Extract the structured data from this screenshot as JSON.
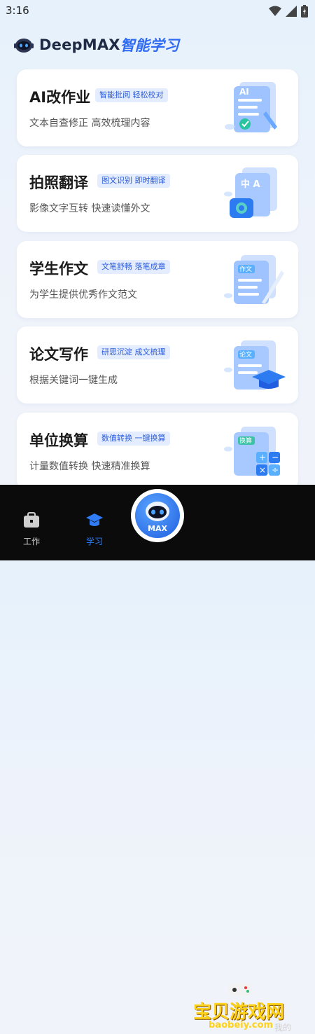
{
  "status_bar": {
    "time": "3:16"
  },
  "header": {
    "brand_en": "DeepMAX",
    "brand_cn": "智能学习"
  },
  "cards": [
    {
      "title": "AI改作业",
      "tags": [
        "智能批阅 轻松校对"
      ],
      "subtitle": "文本自查修正 高效梳理内容",
      "art_label": "AI"
    },
    {
      "title": "拍照翻译",
      "tags": [
        "图文识别 即时翻译"
      ],
      "subtitle": "影像文字互转 快速读懂外文",
      "art_label": "中 A"
    },
    {
      "title": "学生作文",
      "tags": [
        "文笔舒畅 落笔成章"
      ],
      "subtitle": "为学生提供优秀作文范文",
      "art_label": "作文"
    },
    {
      "title": "论文写作",
      "tags": [
        "研思沉淀 成文梳理"
      ],
      "subtitle": "根据关键词一键生成",
      "art_label": "论文"
    },
    {
      "title": "单位换算",
      "tags": [
        "数值转换 一键换算"
      ],
      "subtitle": "计量数值转换 快速精准换算",
      "art_label": "换算"
    }
  ],
  "bottom_nav": {
    "work": "工作",
    "study": "学习",
    "max": "MAX",
    "mine": "我的",
    "active_color": "#2f7cf6"
  },
  "watermark": {
    "text": "宝贝游戏网",
    "url": "baobeiy.com"
  }
}
